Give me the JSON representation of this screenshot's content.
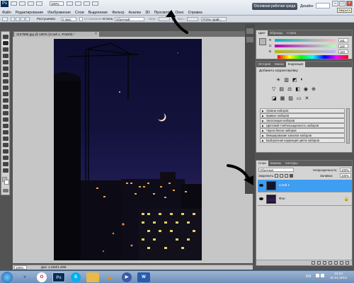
{
  "app": {
    "logo_text": "Ps",
    "zoom": "100%",
    "menu": [
      "Файл",
      "Редактирование",
      "Изображение",
      "Слои",
      "Выделение",
      "Фильтр",
      "Анализ",
      "3D",
      "Просмотр",
      "Окно",
      "Справка"
    ],
    "workspace_button": "Основная рабочая среда",
    "workspace_design": "Дизайн",
    "workspace_more": "»",
    "tooltip_close": "Закрыть",
    "win_min": "–",
    "win_max": "□",
    "win_close": "×"
  },
  "options": {
    "feather_label": "Растушевка:",
    "feather_value": "0 пикс",
    "smooth_label": "Сглаживание",
    "style_label": "Стиль:",
    "style_value": "Обычный",
    "width_label": "Шир.:",
    "height_label": "Выс.:",
    "refine_button": "Уточн. край..."
  },
  "document": {
    "tab_label": "1137985.jpg @ 100% (Слой 1, RGB/8) *",
    "tab_close": "×",
    "zoom_status": "100%",
    "doc_status": "Док: 1,22М/1,46М"
  },
  "color_panel": {
    "tabs": [
      "Цвет",
      "Образцы",
      "Стили"
    ],
    "r_label": "R",
    "g_label": "G",
    "b_label": "B",
    "r_value": "181",
    "g_value": "182",
    "b_value": "184"
  },
  "adjust_panel": {
    "tabs": [
      "История",
      "Маски",
      "Коррекция"
    ],
    "title": "Добавить корректировку",
    "presets": [
      "Уровни наборов",
      "Кривые наборов",
      "Экспозиция наборов",
      "Цветовой тон/Насыщенность наборов",
      "Черно-белое наборов",
      "Микширование каналов наборов",
      "Выборочная коррекция цвета наборов"
    ]
  },
  "layers_panel": {
    "tabs": [
      "Слои",
      "Каналы",
      "Контуры"
    ],
    "blend_mode": "Обычные",
    "opacity_label": "Непрозрачность:",
    "opacity_value": "100%",
    "lock_label": "Закрепить:",
    "fill_label": "Заливка:",
    "fill_value": "100%",
    "layers": [
      {
        "name": "Слой 1",
        "selected": true
      },
      {
        "name": "Фон",
        "selected": false
      }
    ]
  },
  "taskbar": {
    "icons": [
      "start-orb",
      "internet-explorer",
      "opera",
      "photoshop",
      "skype",
      "windows-explorer",
      "vlc",
      "media-player",
      "word"
    ],
    "lang": "EN",
    "time": "13:24",
    "date": "31.01.2014"
  },
  "colors": {
    "layer_selected": "#3f9df2",
    "accent_arrow": "#000000"
  }
}
